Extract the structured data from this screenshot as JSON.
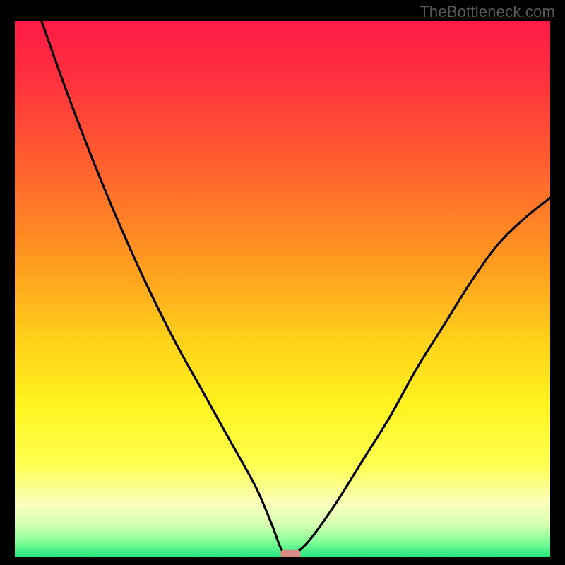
{
  "watermark": "TheBottleneck.com",
  "chart_data": {
    "type": "line",
    "title": "",
    "xlabel": "",
    "ylabel": "",
    "xlim": [
      0,
      100
    ],
    "ylim": [
      0,
      100
    ],
    "grid": false,
    "legend": false,
    "annotations": [],
    "series": [
      {
        "name": "curve",
        "x": [
          5,
          10,
          15,
          20,
          25,
          30,
          35,
          40,
          45,
          48,
          50,
          52,
          55,
          60,
          65,
          70,
          75,
          80,
          85,
          90,
          95,
          100
        ],
        "y": [
          100,
          86,
          73,
          61,
          50,
          40,
          31,
          22,
          13,
          6,
          1,
          0.5,
          3,
          10,
          18,
          26,
          35,
          43,
          51,
          58,
          63,
          67
        ]
      }
    ],
    "minimum_marker": {
      "x": 51.5,
      "y": 0.5,
      "color": "#d98b85"
    },
    "background_gradient_stops": [
      {
        "offset": 0.0,
        "color": "#ff1a47"
      },
      {
        "offset": 0.1,
        "color": "#ff2f3f"
      },
      {
        "offset": 0.25,
        "color": "#ff5a30"
      },
      {
        "offset": 0.45,
        "color": "#ff9a20"
      },
      {
        "offset": 0.6,
        "color": "#ffd21a"
      },
      {
        "offset": 0.72,
        "color": "#fff420"
      },
      {
        "offset": 0.83,
        "color": "#ffff52"
      },
      {
        "offset": 0.9,
        "color": "#fbffba"
      },
      {
        "offset": 0.94,
        "color": "#d6ffb2"
      },
      {
        "offset": 0.97,
        "color": "#8bff9a"
      },
      {
        "offset": 1.0,
        "color": "#24e87e"
      }
    ]
  }
}
